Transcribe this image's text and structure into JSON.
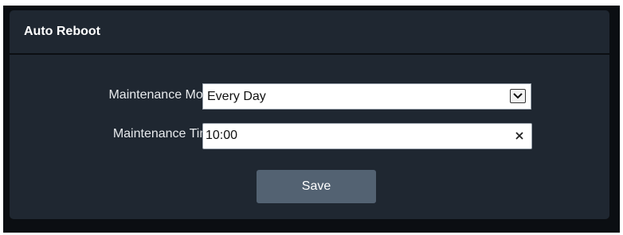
{
  "panel": {
    "title": "Auto Reboot"
  },
  "form": {
    "maintenance_mode": {
      "label": "Maintenance Mode:",
      "selected": "Every Day"
    },
    "maintenance_time": {
      "label": "Maintenance Time:",
      "value": "10:00"
    }
  },
  "actions": {
    "save_label": "Save"
  },
  "icons": {
    "dropdown": "chevron-down-icon",
    "clear": "close-icon"
  }
}
